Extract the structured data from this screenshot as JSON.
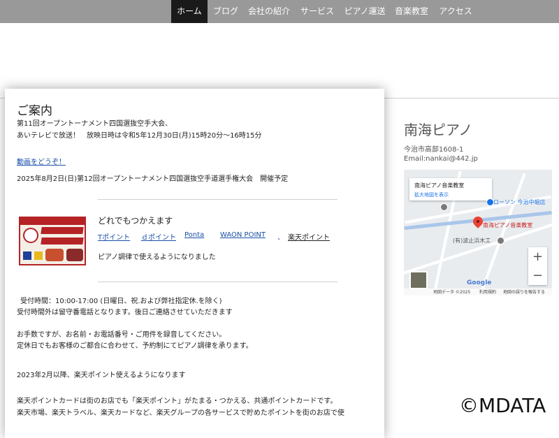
{
  "nav": {
    "items": [
      {
        "label": "ホーム",
        "active": true
      },
      {
        "label": "ブログ"
      },
      {
        "label": "会社の紹介"
      },
      {
        "label": "サービス"
      },
      {
        "label": "ピアノ運送"
      },
      {
        "label": "音楽教室"
      },
      {
        "label": "アクセス"
      }
    ]
  },
  "main": {
    "title": "ご案内",
    "lines": [
      "第11回オープントーナメント四国選抜空手大会、",
      "あいテレビで放送！　放映日時は令和5年12月30日(月)15時20分～16時15分"
    ],
    "video_link": "動画をどうぞ！",
    "event": "2025年8月2日(日)第12回オープントーナメント四国選抜空手道選手権大会　開催予定",
    "banner": {
      "top_text": "お金計時にポイントカードのご提示を！",
      "badge": "当店",
      "line1": "どれでも",
      "line2": "つかえます"
    },
    "points_heading": "どれでもつかえます",
    "points": [
      "Tポイント",
      "ｄポイント",
      "Ponta",
      "WAON POINT",
      "、",
      "楽天ポイント"
    ],
    "piano_note": "ピアノ調律で使えるようになりました",
    "hours1": "受付時間：10:00-17:00 (日曜日、祝.および弊社指定休.を除く)",
    "hours2": "受付時間外は留守番電話となります。後日ご連絡させていただきます",
    "msg1": "お手数ですが、お名前・お電話番号・ご用件を録音してください。",
    "msg2": "定休日でもお客様のご都合に合わせて、予約制にてピアノ調律を承ります。",
    "rakuten_since": "2023年2月以降、楽天ポイント使えるようになります",
    "rakuten1": "楽天ポイントカードは街のお店でも「楽天ポイント」がたまる・つかえる、共通ポイントカードです。",
    "rakuten2": "楽天市場、楽天トラベル、楽天カードなど、楽天グループの各サービスで貯めたポイントを街のお店で使"
  },
  "sidebar": {
    "title": "南海ピアノ",
    "address": "今治市高部1608-1",
    "email": "Email:nankai@442.jp"
  },
  "map": {
    "card_title": "南海ピアノ音楽教室",
    "card_link": "拡大地図を表示",
    "label_lawson": "ローソン 今治中堀店",
    "label_marker": "南海ピアノ音楽教室",
    "label_wood": "(有)波止浜木工",
    "google": "Google",
    "zoom_in": "+",
    "zoom_out": "−",
    "footer_data": "地図データ ©2025",
    "footer_terms": "利用規約",
    "footer_report": "地図の誤りを報告する"
  },
  "watermark": "©MDATA"
}
